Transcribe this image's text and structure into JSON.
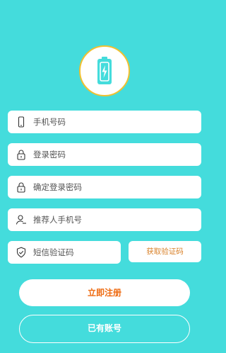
{
  "logo": {
    "icon": "battery-charge-icon",
    "ring_color": "#f0c030",
    "color": "#44dcdc"
  },
  "form": {
    "phone": {
      "placeholder": "手机号码",
      "icon": "phone-icon"
    },
    "password": {
      "placeholder": "登录密码",
      "icon": "lock-icon"
    },
    "confirm_password": {
      "placeholder": "确定登录密码",
      "icon": "lock-icon"
    },
    "referrer_phone": {
      "placeholder": "推荐人手机号",
      "icon": "user-add-icon"
    },
    "sms_code": {
      "placeholder": "短信验证码",
      "icon": "shield-check-icon"
    }
  },
  "buttons": {
    "get_code": "获取验证码",
    "register": "立即注册",
    "have_account": "已有账号"
  },
  "colors": {
    "background": "#44dcdc",
    "accent": "#ee6a10",
    "code_button_text": "#d9822b"
  }
}
